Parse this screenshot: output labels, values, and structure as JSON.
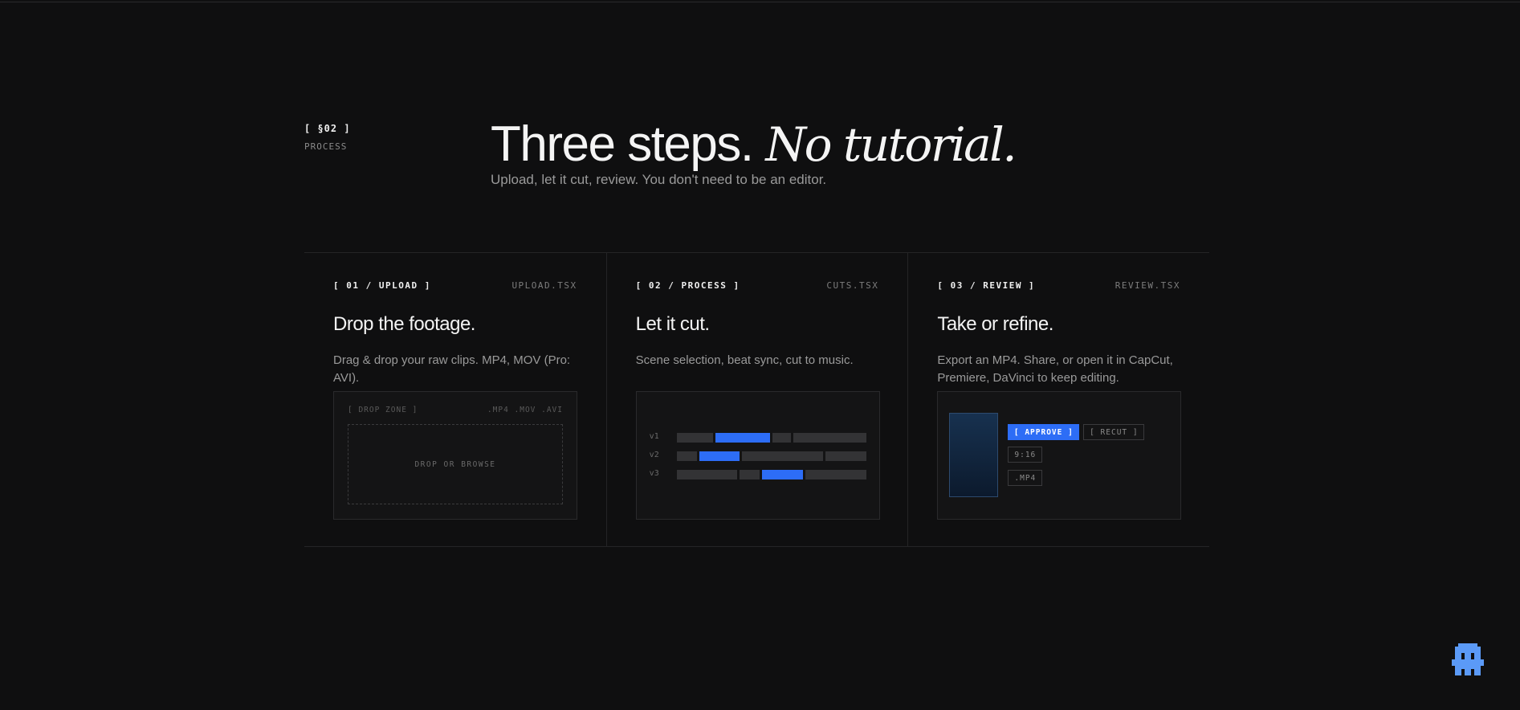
{
  "section": {
    "number": "[ §02 ]",
    "label": "PROCESS"
  },
  "hero": {
    "title_main": "Three steps.",
    "title_italic": "No tutorial.",
    "subtitle": "Upload, let it cut, review. You don't need to be an editor."
  },
  "cards": [
    {
      "step": "[ 01 / UPLOAD ]",
      "file": "UPLOAD.TSX",
      "title": "Drop the footage.",
      "desc": "Drag & drop your raw clips. MP4, MOV (Pro: AVI).",
      "panel": {
        "zone_label": "[ DROP ZONE ]",
        "formats": ".MP4 .MOV .AVI",
        "drop_text": "DROP OR BROWSE"
      }
    },
    {
      "step": "[ 02 / PROCESS ]",
      "file": "CUTS.TSX",
      "title": "Let it cut.",
      "desc": "Scene selection, beat sync, cut to music.",
      "panel": {
        "tracks": [
          "v1",
          "v2",
          "v3"
        ]
      }
    },
    {
      "step": "[ 03 / REVIEW ]",
      "file": "REVIEW.TSX",
      "title": "Take or refine.",
      "desc": "Export an MP4. Share, or open it in CapCut, Premiere, DaVinci to keep editing.",
      "panel": {
        "approve": "[ APPROVE ]",
        "recut": "[ RECUT ]",
        "ratio": "9:16",
        "format": ".MP4"
      }
    }
  ],
  "colors": {
    "background": "#0f0f10",
    "accent": "#2d6df6",
    "mascot": "#5b9af7"
  },
  "icons": {
    "mascot": "pixel-ghost-icon"
  }
}
